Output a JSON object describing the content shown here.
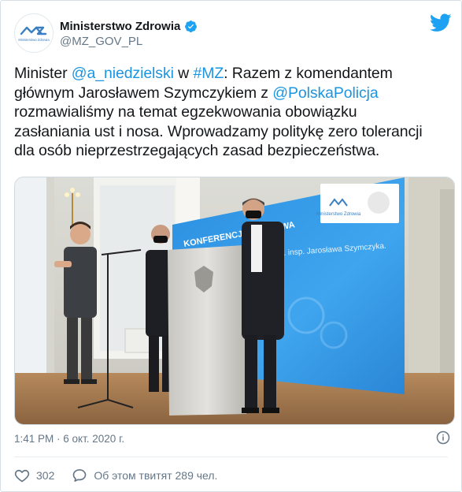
{
  "author": {
    "display_name": "Ministerstwo Zdrowia",
    "handle": "@MZ_GOV_PL",
    "avatar_logo_text": "Ministerstwo Zdrowia"
  },
  "tweet": {
    "lines": [
      [
        {
          "t": "Minister "
        },
        {
          "t": "@a_niedzielski",
          "link": true
        },
        {
          "t": " w "
        },
        {
          "t": "#MZ",
          "link": true
        },
        {
          "t": ": Razem z komendantem"
        }
      ],
      [
        {
          "t": "głównym Jarosławem Szymczykiem z "
        },
        {
          "t": "@PolskaPolicja",
          "link": true
        }
      ],
      [
        {
          "t": "rozmawialiśmy na temat egzekwowania obowiązku"
        }
      ],
      [
        {
          "t": "zasłaniania ust i nosa. Wprowadzamy politykę zero tolerancji"
        }
      ],
      [
        {
          "t": "dla osób nieprzestrzegających zasad bezpieczeństwa."
        }
      ]
    ]
  },
  "media": {
    "banner_text": "KONFERENCJA PRASOWA",
    "screen_text": "gen. insp. Jarosława Szymczyka.",
    "screen_logo_text": "Ministerstwo Zdrowia"
  },
  "meta": {
    "timestamp": "1:41 PM · 6 окт. 2020 г."
  },
  "actions": {
    "likes": "302",
    "discussion": "Об этом твитят 289 чел."
  },
  "colors": {
    "link": "#1b95e0",
    "twitter_blue": "#1da1f2",
    "secondary_text": "#657786"
  }
}
